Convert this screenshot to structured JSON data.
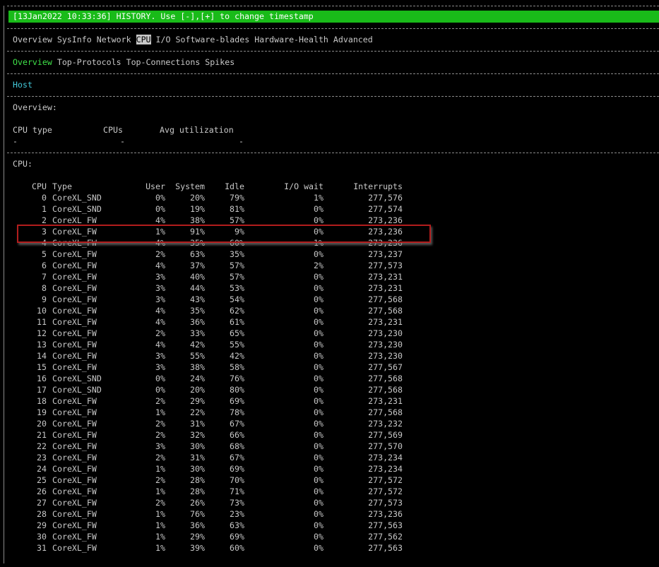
{
  "status_bar": "[13Jan2022 10:33:36] HISTORY. Use [-],[+] to change timestamp",
  "menu": {
    "items": [
      "Overview",
      "SysInfo",
      "Network",
      "CPU",
      "I/O",
      "Software-blades",
      "Hardware-Health",
      "Advanced"
    ],
    "selected": "CPU"
  },
  "submenu": {
    "items": [
      "Overview",
      "Top-Protocols",
      "Top-Connections",
      "Spikes"
    ],
    "active": "Overview"
  },
  "host_label": "Host",
  "overview": {
    "title": "Overview:",
    "headers": {
      "cpu_type": "CPU type",
      "cpus": "CPUs",
      "avg_util": "Avg utilization"
    },
    "values": {
      "cpu_type": "-",
      "cpus": "-",
      "avg_util": "-"
    }
  },
  "cpu_section": {
    "title": "CPU:",
    "headers": {
      "cpu": "CPU",
      "type": "Type",
      "user": "User",
      "system": "System",
      "idle": "Idle",
      "io_wait": "I/O wait",
      "interrupts": "Interrupts"
    },
    "rows": [
      {
        "cpu": "0",
        "type": "CoreXL_SND",
        "user": "0%",
        "system": "20%",
        "idle": "79%",
        "io_wait": "1%",
        "interrupts": "277,576"
      },
      {
        "cpu": "1",
        "type": "CoreXL_SND",
        "user": "0%",
        "system": "19%",
        "idle": "81%",
        "io_wait": "0%",
        "interrupts": "277,574"
      },
      {
        "cpu": "2",
        "type": "CoreXL_FW",
        "user": "4%",
        "system": "38%",
        "idle": "57%",
        "io_wait": "0%",
        "interrupts": "273,236"
      },
      {
        "cpu": "3",
        "type": "CoreXL_FW",
        "user": "1%",
        "system": "91%",
        "idle": "9%",
        "io_wait": "0%",
        "interrupts": "273,236"
      },
      {
        "cpu": "4",
        "type": "CoreXL_FW",
        "user": "4%",
        "system": "35%",
        "idle": "60%",
        "io_wait": "1%",
        "interrupts": "273,236"
      },
      {
        "cpu": "5",
        "type": "CoreXL_FW",
        "user": "2%",
        "system": "63%",
        "idle": "35%",
        "io_wait": "0%",
        "interrupts": "273,237"
      },
      {
        "cpu": "6",
        "type": "CoreXL_FW",
        "user": "4%",
        "system": "37%",
        "idle": "57%",
        "io_wait": "2%",
        "interrupts": "277,573"
      },
      {
        "cpu": "7",
        "type": "CoreXL_FW",
        "user": "3%",
        "system": "40%",
        "idle": "57%",
        "io_wait": "0%",
        "interrupts": "273,231"
      },
      {
        "cpu": "8",
        "type": "CoreXL_FW",
        "user": "3%",
        "system": "44%",
        "idle": "53%",
        "io_wait": "0%",
        "interrupts": "273,231"
      },
      {
        "cpu": "9",
        "type": "CoreXL_FW",
        "user": "3%",
        "system": "43%",
        "idle": "54%",
        "io_wait": "0%",
        "interrupts": "277,568"
      },
      {
        "cpu": "10",
        "type": "CoreXL_FW",
        "user": "4%",
        "system": "35%",
        "idle": "62%",
        "io_wait": "0%",
        "interrupts": "277,568"
      },
      {
        "cpu": "11",
        "type": "CoreXL_FW",
        "user": "4%",
        "system": "36%",
        "idle": "61%",
        "io_wait": "0%",
        "interrupts": "273,231"
      },
      {
        "cpu": "12",
        "type": "CoreXL_FW",
        "user": "2%",
        "system": "33%",
        "idle": "65%",
        "io_wait": "0%",
        "interrupts": "273,230"
      },
      {
        "cpu": "13",
        "type": "CoreXL_FW",
        "user": "4%",
        "system": "42%",
        "idle": "55%",
        "io_wait": "0%",
        "interrupts": "273,230"
      },
      {
        "cpu": "14",
        "type": "CoreXL_FW",
        "user": "3%",
        "system": "55%",
        "idle": "42%",
        "io_wait": "0%",
        "interrupts": "273,230"
      },
      {
        "cpu": "15",
        "type": "CoreXL_FW",
        "user": "3%",
        "system": "38%",
        "idle": "58%",
        "io_wait": "0%",
        "interrupts": "277,567"
      },
      {
        "cpu": "16",
        "type": "CoreXL_SND",
        "user": "0%",
        "system": "24%",
        "idle": "76%",
        "io_wait": "0%",
        "interrupts": "277,568"
      },
      {
        "cpu": "17",
        "type": "CoreXL_SND",
        "user": "0%",
        "system": "20%",
        "idle": "80%",
        "io_wait": "0%",
        "interrupts": "277,568"
      },
      {
        "cpu": "18",
        "type": "CoreXL_FW",
        "user": "2%",
        "system": "29%",
        "idle": "69%",
        "io_wait": "0%",
        "interrupts": "273,231"
      },
      {
        "cpu": "19",
        "type": "CoreXL_FW",
        "user": "1%",
        "system": "22%",
        "idle": "78%",
        "io_wait": "0%",
        "interrupts": "277,568"
      },
      {
        "cpu": "20",
        "type": "CoreXL_FW",
        "user": "2%",
        "system": "31%",
        "idle": "67%",
        "io_wait": "0%",
        "interrupts": "273,232"
      },
      {
        "cpu": "21",
        "type": "CoreXL_FW",
        "user": "2%",
        "system": "32%",
        "idle": "66%",
        "io_wait": "0%",
        "interrupts": "277,569"
      },
      {
        "cpu": "22",
        "type": "CoreXL_FW",
        "user": "3%",
        "system": "30%",
        "idle": "68%",
        "io_wait": "0%",
        "interrupts": "277,570"
      },
      {
        "cpu": "23",
        "type": "CoreXL_FW",
        "user": "2%",
        "system": "31%",
        "idle": "67%",
        "io_wait": "0%",
        "interrupts": "273,234"
      },
      {
        "cpu": "24",
        "type": "CoreXL_FW",
        "user": "1%",
        "system": "30%",
        "idle": "69%",
        "io_wait": "0%",
        "interrupts": "273,234"
      },
      {
        "cpu": "25",
        "type": "CoreXL_FW",
        "user": "2%",
        "system": "28%",
        "idle": "70%",
        "io_wait": "0%",
        "interrupts": "277,572"
      },
      {
        "cpu": "26",
        "type": "CoreXL_FW",
        "user": "1%",
        "system": "28%",
        "idle": "71%",
        "io_wait": "0%",
        "interrupts": "277,572"
      },
      {
        "cpu": "27",
        "type": "CoreXL_FW",
        "user": "2%",
        "system": "26%",
        "idle": "73%",
        "io_wait": "0%",
        "interrupts": "277,573"
      },
      {
        "cpu": "28",
        "type": "CoreXL_FW",
        "user": "1%",
        "system": "76%",
        "idle": "23%",
        "io_wait": "0%",
        "interrupts": "273,236"
      },
      {
        "cpu": "29",
        "type": "CoreXL_FW",
        "user": "1%",
        "system": "36%",
        "idle": "63%",
        "io_wait": "0%",
        "interrupts": "277,563"
      },
      {
        "cpu": "30",
        "type": "CoreXL_FW",
        "user": "1%",
        "system": "29%",
        "idle": "69%",
        "io_wait": "0%",
        "interrupts": "277,562"
      },
      {
        "cpu": "31",
        "type": "CoreXL_FW",
        "user": "1%",
        "system": "39%",
        "idle": "60%",
        "io_wait": "0%",
        "interrupts": "277,563"
      }
    ]
  },
  "colors": {
    "status_bg": "#19bb19",
    "active_green": "#3fe048",
    "host_cyan": "#43c8d8",
    "highlight_red": "#b21d1d"
  }
}
